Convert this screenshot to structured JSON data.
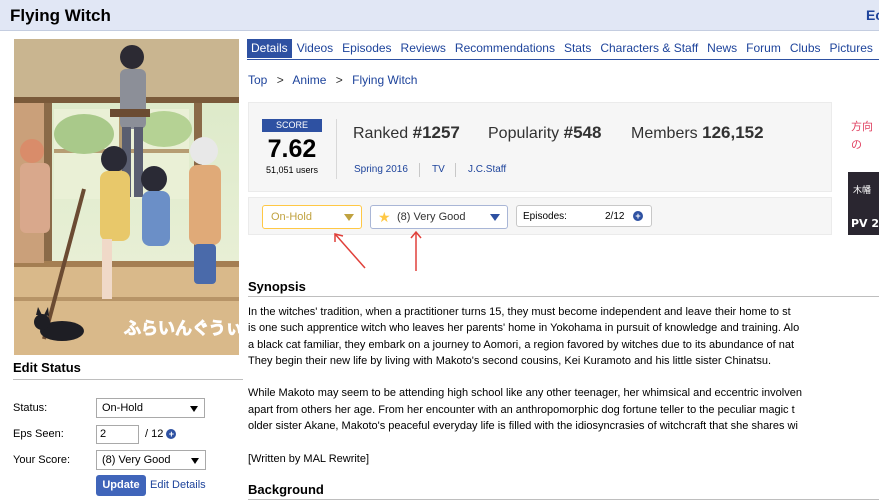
{
  "header": {
    "title": "Flying Witch",
    "edit_link": "Ec"
  },
  "tabs": [
    "Details",
    "Videos",
    "Episodes",
    "Reviews",
    "Recommendations",
    "Stats",
    "Characters & Staff",
    "News",
    "Forum",
    "Clubs",
    "Pictures"
  ],
  "breadcrumb": [
    "Top",
    "Anime",
    "Flying Witch"
  ],
  "breadcrumb_sep": ">",
  "score": {
    "label": "SCORE",
    "value": "7.62",
    "users": "51,051 users"
  },
  "stats": {
    "ranked_label": "Ranked",
    "ranked_value": "#1257",
    "popularity_label": "Popularity",
    "popularity_value": "#548",
    "members_label": "Members",
    "members_value": "126,152"
  },
  "meta": {
    "season": "Spring 2016",
    "type": "TV",
    "studio": "J.C.Staff"
  },
  "user_status": {
    "status": "On-Hold",
    "score": "(8) Very Good",
    "episodes_label": "Episodes:",
    "episodes_value": "2/12"
  },
  "edit_status": {
    "title": "Edit Status",
    "status_label": "Status:",
    "status_value": "On-Hold",
    "eps_label": "Eps Seen:",
    "eps_value": "2",
    "eps_total": "/ 12",
    "score_label": "Your Score:",
    "score_value": "(8) Very Good",
    "update_button": "Update",
    "edit_details": "Edit Details"
  },
  "synopsis": {
    "title": "Synopsis",
    "lines": [
      "In the witches' tradition, when a practitioner turns 15, they must become independent and leave their home to st",
      "is one such apprentice witch who leaves her parents' home in Yokohama in pursuit of knowledge and training. Alo",
      "a black cat familiar, they embark on a journey to Aomori, a region favored by witches due to its abundance of nat",
      "They begin their new life by living with Makoto's second cousins, Kei Kuramoto and his little sister Chinatsu.",
      "",
      "While Makoto may seem to be attending high school like any other teenager, her whimsical and eccentric involven",
      "apart from others her age. From her encounter with an anthropomorphic dog fortune teller to the peculiar magic t",
      "older sister Akane, Makoto's peaceful everyday life is filled with the idiosyncrasies of witchcraft that she shares wi",
      "",
      "[Written by MAL Rewrite]"
    ]
  },
  "background": {
    "title": "Background"
  },
  "poster": {
    "logo_text": "ふらいんぐうぃっち"
  },
  "ad": {
    "text_1": "方向",
    "text_2": "の",
    "text_3": "木幡",
    "text_4": "PV 2"
  },
  "colors": {
    "brand": "#2e51a2",
    "header_bg": "#e1e7f5",
    "onhold": "#c0a240",
    "arrow": "#e0403a"
  }
}
